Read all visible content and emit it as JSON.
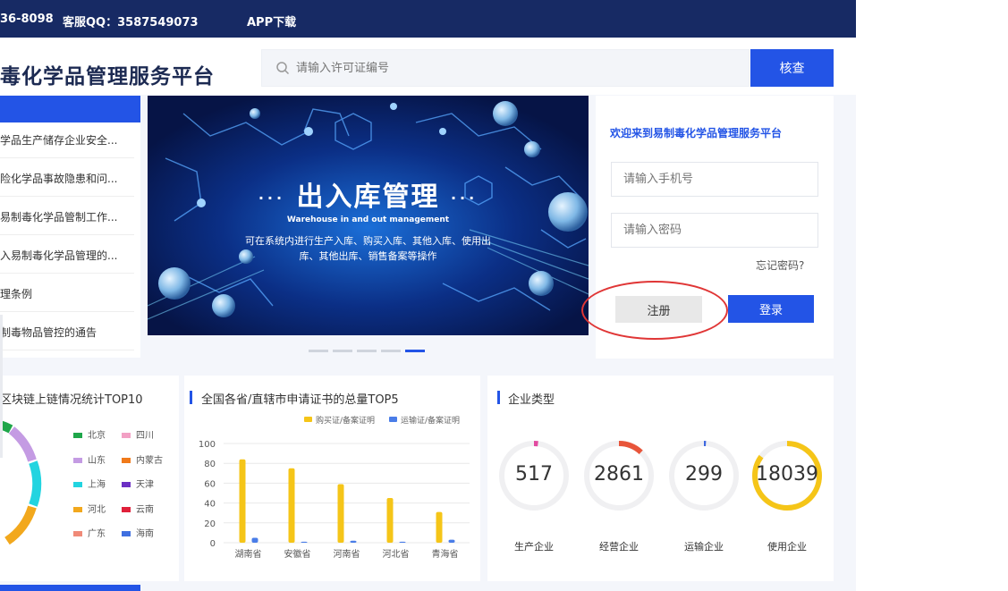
{
  "topbar": {
    "hotline": "36-8098",
    "qq": "客服QQ：3587549073",
    "app_download": "APP下载"
  },
  "header": {
    "site_title": "毒化学品管理服务平台",
    "search_placeholder": "请输入许可证编号",
    "search_button": "核查"
  },
  "news": {
    "items": [
      "学品生产储存企业安全...",
      "险化学品事故隐患和问...",
      "易制毒化学品管制工作...",
      "入易制毒化学品管理的...",
      "理条例",
      "制毒物品管控的通告"
    ]
  },
  "banner": {
    "title": "出入库管理",
    "subtitle": "Warehouse in and out management",
    "description": "可在系统内进行生产入库、购买入库、其他入库、使用出库、其他出库、销售备案等操作",
    "slide_count": 5,
    "active_slide": 5
  },
  "login": {
    "title": "欢迎来到易制毒化学品管理服务平台",
    "phone_placeholder": "请输入手机号",
    "password_placeholder": "请输入密码",
    "forgot": "忘记密码?",
    "register": "注册",
    "login": "登录"
  },
  "sections": {
    "blockchain_title": "区块链上链情况统计TOP10",
    "certificates_title": "全国各省/直辖市申请证书的总量TOP5",
    "company_types_title": "企业类型"
  },
  "colors": {
    "primary": "#2354e6",
    "topbar": "#172a64",
    "bar_yellow": "#f5c518",
    "bar_blue": "#4a7de8",
    "annotation_red": "#e03636"
  },
  "blockchain_legend": [
    {
      "name": "北京",
      "color": "#1fa64a"
    },
    {
      "name": "四川",
      "color": "#f2a0c4"
    },
    {
      "name": "山东",
      "color": "#c49be3"
    },
    {
      "name": "内蒙古",
      "color": "#f07a1a"
    },
    {
      "name": "上海",
      "color": "#22d4e0"
    },
    {
      "name": "天津",
      "color": "#6c2fc4"
    },
    {
      "name": "河北",
      "color": "#f2a81d"
    },
    {
      "name": "云南",
      "color": "#e0203a"
    },
    {
      "name": "广东",
      "color": "#f08a78"
    },
    {
      "name": "海南",
      "color": "#3f6fe0"
    }
  ],
  "chart_data": {
    "type": "bar",
    "title": "",
    "categories": [
      "湖南省",
      "安徽省",
      "河南省",
      "河北省",
      "青海省"
    ],
    "series": [
      {
        "name": "购买证/备案证明",
        "values": [
          84,
          75,
          59,
          45,
          31
        ]
      },
      {
        "name": "运输证/备案证明",
        "values": [
          5,
          1,
          2,
          1,
          3
        ]
      }
    ],
    "y_ticks": [
      "100",
      "80",
      "60",
      "40",
      "20",
      "0"
    ],
    "ylim": [
      0,
      100
    ],
    "legend_position": "top-right",
    "grid": true
  },
  "company_types": [
    {
      "value": "517",
      "label": "生产企业",
      "fraction": 0.02,
      "color": "#e24aa0"
    },
    {
      "value": "2861",
      "label": "经营企业",
      "fraction": 0.12,
      "color": "#e8553a"
    },
    {
      "value": "299",
      "label": "运输企业",
      "fraction": 0.01,
      "color": "#3d68e0"
    },
    {
      "value": "18039",
      "label": "使用企业",
      "fraction": 0.85,
      "color": "#f5c518"
    }
  ]
}
